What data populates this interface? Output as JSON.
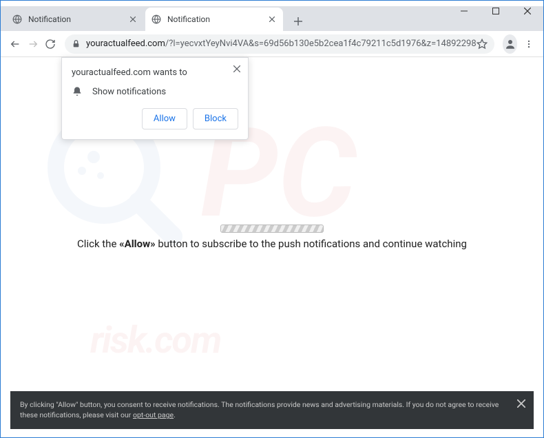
{
  "window": {
    "tabs": [
      {
        "title": "Notification"
      },
      {
        "title": "Notification"
      }
    ],
    "url_domain": "youractualfeed.com",
    "url_path": "/?l=yecvxtYeyNvi4VA&s=69d56b130e5b2cea1f4c79211c5d1976&z=14892298"
  },
  "permission": {
    "title": "youractualfeed.com wants to",
    "item": "Show notifications",
    "allow": "Allow",
    "block": "Block"
  },
  "page": {
    "instruction_pre": "Click the ",
    "instruction_bold": "«Allow»",
    "instruction_post": " button to subscribe to the push notifications and continue watching"
  },
  "consent": {
    "text_part1": "By clicking \"Allow\" button, you consent to receive notifications. The notifications provide news and advertising materials. If you do not agree to receive these notifications, please visit our ",
    "link": "opt-out page",
    "text_part2": "."
  },
  "watermark2": "risk.com"
}
